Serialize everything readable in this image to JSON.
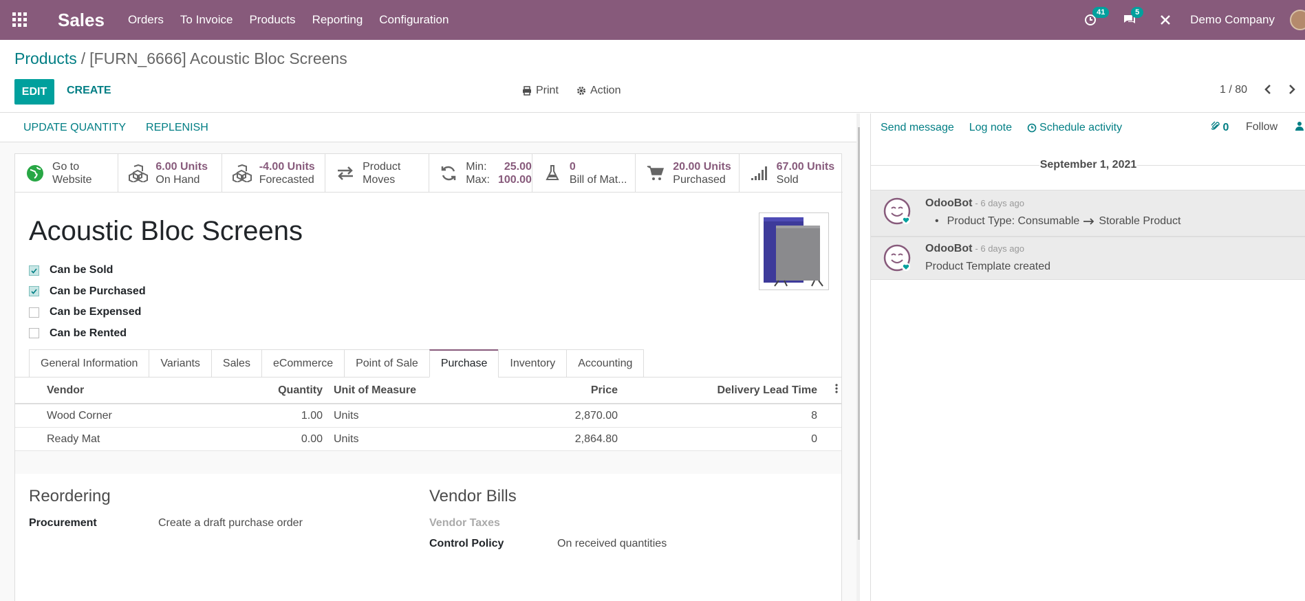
{
  "topbar": {
    "app_name": "Sales",
    "menu": [
      "Orders",
      "To Invoice",
      "Products",
      "Reporting",
      "Configuration"
    ],
    "activity_count": "41",
    "message_count": "5",
    "company": "Demo Company"
  },
  "breadcrumb": {
    "parent": "Products",
    "separator": "/",
    "current": "[FURN_6666] Acoustic Bloc Screens"
  },
  "buttons": {
    "edit": "EDIT",
    "create": "CREATE",
    "print": "Print",
    "action": "Action"
  },
  "pager": {
    "value": "1 / 80"
  },
  "statusbar": {
    "update_quantity": "UPDATE QUANTITY",
    "replenish": "REPLENISH"
  },
  "smart_buttons": {
    "website": {
      "line1": "Go to",
      "line2": "Website"
    },
    "on_hand": {
      "value": "6.00 Units",
      "label": "On Hand"
    },
    "forecasted": {
      "value": "-4.00 Units",
      "label": "Forecasted"
    },
    "moves": {
      "line1": "Product",
      "line2": "Moves"
    },
    "minmax": {
      "min_label": "Min:",
      "min_value": "25.00",
      "max_label": "Max:",
      "max_value": "100.00"
    },
    "bom": {
      "value": "0",
      "label": "Bill of Mat..."
    },
    "purchased": {
      "value": "20.00 Units",
      "label": "Purchased"
    },
    "sold": {
      "value": "67.00 Units",
      "label": "Sold"
    }
  },
  "product": {
    "name": "Acoustic Bloc Screens",
    "options": [
      {
        "label": "Can be Sold",
        "checked": true
      },
      {
        "label": "Can be Purchased",
        "checked": true
      },
      {
        "label": "Can be Expensed",
        "checked": false
      },
      {
        "label": "Can be Rented",
        "checked": false
      }
    ]
  },
  "tabs": [
    "General Information",
    "Variants",
    "Sales",
    "eCommerce",
    "Point of Sale",
    "Purchase",
    "Inventory",
    "Accounting"
  ],
  "active_tab": "Purchase",
  "vendor_table": {
    "headers": {
      "vendor": "Vendor",
      "quantity": "Quantity",
      "uom": "Unit of Measure",
      "price": "Price",
      "lead": "Delivery Lead Time"
    },
    "rows": [
      {
        "vendor": "Wood Corner",
        "quantity": "1.00",
        "uom": "Units",
        "price": "2,870.00",
        "lead": "8"
      },
      {
        "vendor": "Ready Mat",
        "quantity": "0.00",
        "uom": "Units",
        "price": "2,864.80",
        "lead": "0"
      }
    ]
  },
  "reordering": {
    "title": "Reordering",
    "procurement_label": "Procurement",
    "procurement_value": "Create a draft purchase order"
  },
  "vendor_bills": {
    "title": "Vendor Bills",
    "taxes_label": "Vendor Taxes",
    "control_label": "Control Policy",
    "control_value": "On received quantities"
  },
  "chatter": {
    "send_message": "Send message",
    "log_note": "Log note",
    "schedule_activity": "Schedule activity",
    "attachments": "0",
    "follow": "Follow",
    "date": "September 1, 2021",
    "messages": [
      {
        "author": "OdooBot",
        "date": "- 6 days ago",
        "body_prefix": "Product Type: Consumable",
        "body_suffix": "Storable Product"
      },
      {
        "author": "OdooBot",
        "date": "- 6 days ago",
        "body": "Product Template created"
      }
    ]
  },
  "colors": {
    "primary": "#875a7b",
    "accent": "#00a09d",
    "link": "#017e84"
  }
}
